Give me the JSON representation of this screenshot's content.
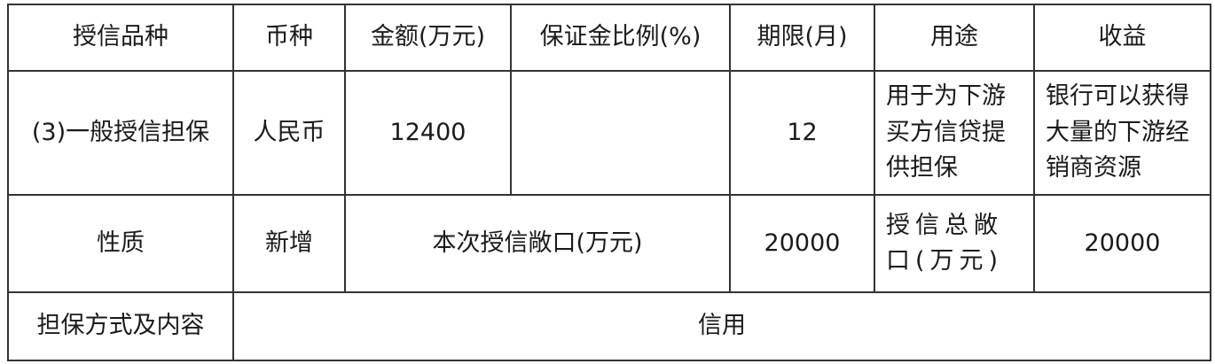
{
  "table": {
    "headers": {
      "type": "授信品种",
      "currency": "币种",
      "amount": "金额(万元)",
      "margin_ratio": "保证金比例(%)",
      "term": "期限(月)",
      "purpose": "用途",
      "benefit": "收益"
    },
    "row1": {
      "type": "(3)一般授信担保",
      "currency": "人民币",
      "amount": "12400",
      "margin_ratio": "",
      "term": "12",
      "purpose": "用于为下游买方信贷提供担保",
      "benefit": "银行可以获得大量的下游经销商资源"
    },
    "row2": {
      "nature_label": "性质",
      "nature_value": "新增",
      "exposure_label": "本次授信敞口(万元)",
      "exposure_value": "20000",
      "total_exposure_label": "授信总敞口(万元)",
      "total_exposure_value": "20000"
    },
    "row3": {
      "guarantee_label": "担保方式及内容",
      "guarantee_value": "信用"
    }
  }
}
